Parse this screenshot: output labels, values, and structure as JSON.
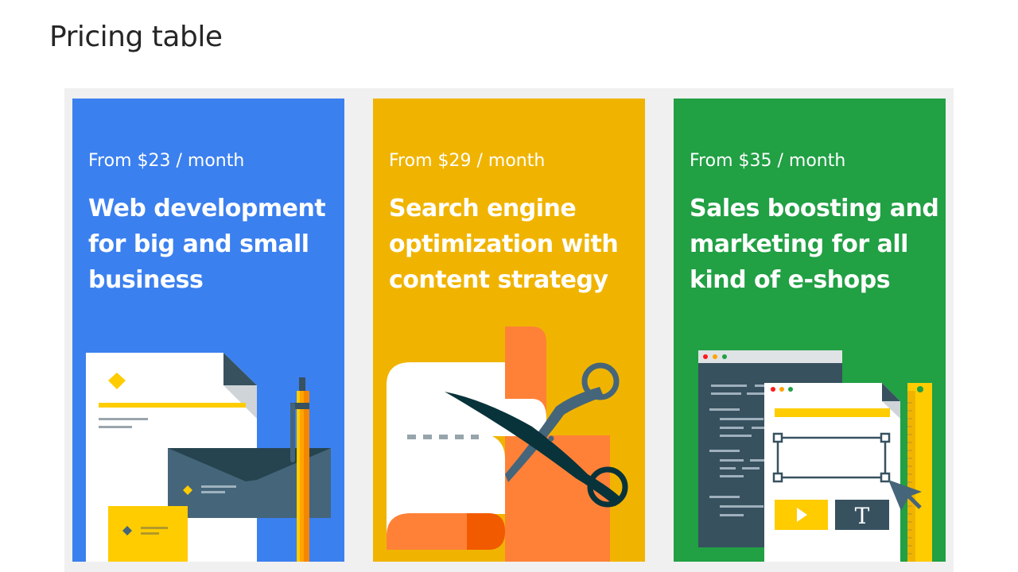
{
  "page": {
    "title": "Pricing table"
  },
  "colors": {
    "blue": "#3b80ef",
    "yellow": "#f0b400",
    "green": "#21a044",
    "panel": "#f0f0f0"
  },
  "plans": [
    {
      "price": "From $23 / month",
      "name": "Web development for big and small business",
      "illustration": "stationery-icon"
    },
    {
      "price": "From $29 / month",
      "name": "Search engine optimization with content strategy",
      "illustration": "scissors-cutting-paper-icon"
    },
    {
      "price": "From $35 / month",
      "name": "Sales boosting and marketing for all kind of e-shops",
      "illustration": "web-design-editor-icon"
    }
  ]
}
